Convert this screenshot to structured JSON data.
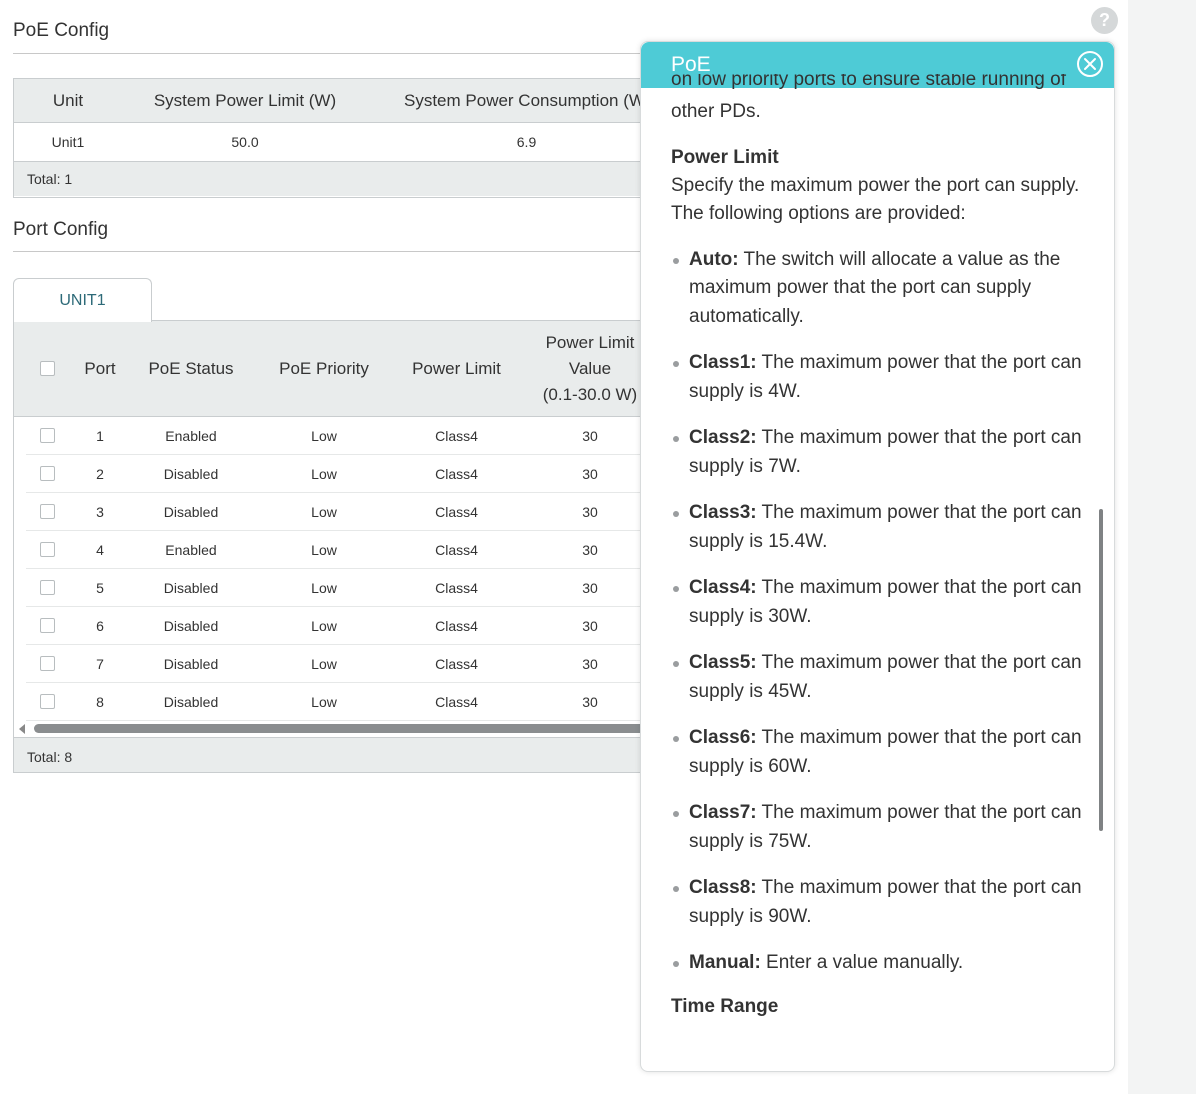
{
  "poe_config": {
    "title": "PoE Config",
    "headers": [
      "Unit",
      "System Power Limit (W)",
      "System Power Consumption (W"
    ],
    "row": [
      "Unit1",
      "50.0",
      "6.9"
    ],
    "total": "Total: 1"
  },
  "port_config": {
    "title": "Port Config",
    "tab": "UNIT1",
    "headers": {
      "port": "Port",
      "poe_status": "PoE Status",
      "poe_priority": "PoE Priority",
      "power_limit": "Power Limit",
      "plv_line1": "Power Limit",
      "plv_line2": "Value",
      "plv_line3": "(0.1-30.0 W)"
    },
    "rows": [
      [
        "1",
        "Enabled",
        "Low",
        "Class4",
        "30"
      ],
      [
        "2",
        "Disabled",
        "Low",
        "Class4",
        "30"
      ],
      [
        "3",
        "Disabled",
        "Low",
        "Class4",
        "30"
      ],
      [
        "4",
        "Enabled",
        "Low",
        "Class4",
        "30"
      ],
      [
        "5",
        "Disabled",
        "Low",
        "Class4",
        "30"
      ],
      [
        "6",
        "Disabled",
        "Low",
        "Class4",
        "30"
      ],
      [
        "7",
        "Disabled",
        "Low",
        "Class4",
        "30"
      ],
      [
        "8",
        "Disabled",
        "Low",
        "Class4",
        "30"
      ]
    ],
    "total": "Total: 8"
  },
  "help_panel": {
    "title": "PoE",
    "partial_line": "on low priority ports to ensure stable running of",
    "partial_line2": "other PDs.",
    "heading_power_limit": "Power Limit",
    "power_limit_desc": "Specify the maximum power the port can supply. The following options are provided:",
    "options": [
      {
        "term": "Auto:",
        "text": " The switch will allocate a value as the maximum power that the port can supply automatically."
      },
      {
        "term": "Class1:",
        "text": " The maximum power that the port can supply is 4W."
      },
      {
        "term": "Class2:",
        "text": " The maximum power that the port can supply is 7W."
      },
      {
        "term": "Class3:",
        "text": " The maximum power that the port can supply is 15.4W."
      },
      {
        "term": "Class4:",
        "text": " The maximum power that the port can supply is 30W."
      },
      {
        "term": "Class5:",
        "text": " The maximum power that the port can supply is 45W."
      },
      {
        "term": "Class6:",
        "text": " The maximum power that the port can supply is 60W."
      },
      {
        "term": "Class7:",
        "text": " The maximum power that the port can supply is 75W."
      },
      {
        "term": "Class8:",
        "text": " The maximum power that the port can supply is 90W."
      },
      {
        "term": "Manual:",
        "text": " Enter a value manually."
      }
    ],
    "heading_time_range": "Time Range"
  },
  "icons": {
    "help": "question-icon",
    "close": "close-icon"
  },
  "colors": {
    "accent": "#4ecbd6",
    "tab_text": "#2d6a78",
    "header_bg": "#e9ecec"
  }
}
